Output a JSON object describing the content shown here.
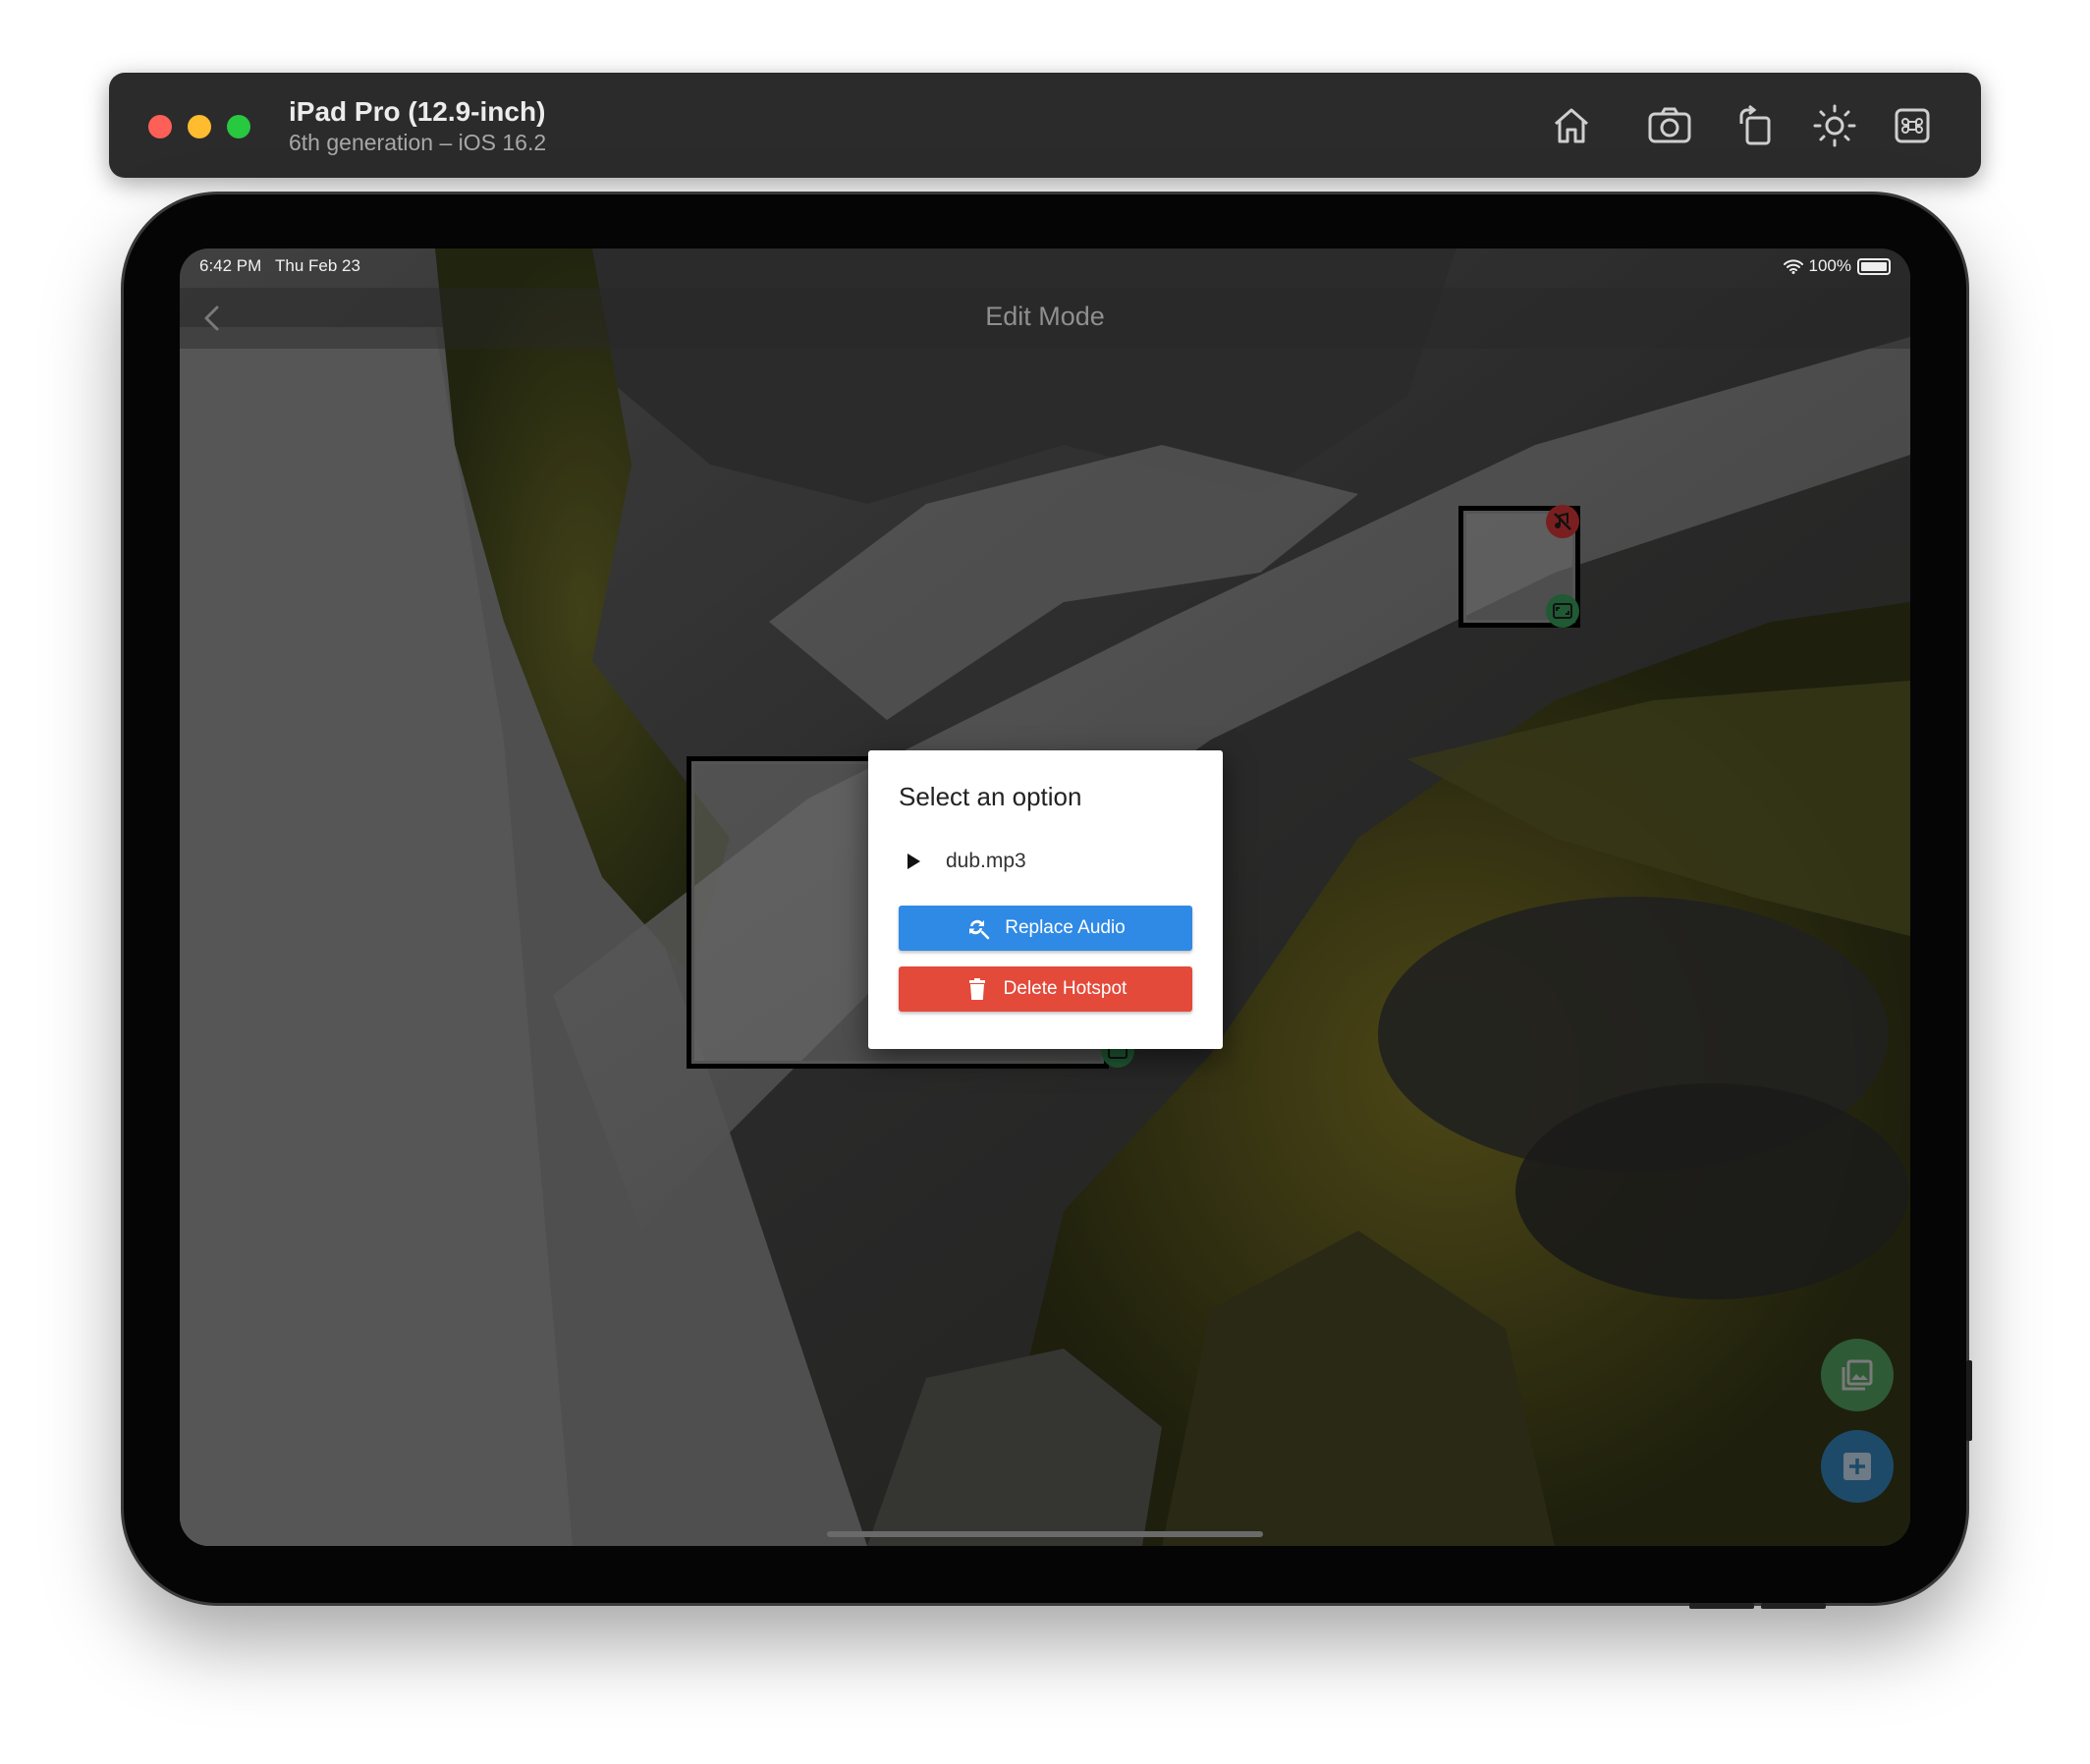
{
  "simulator": {
    "device_name": "iPad Pro (12.9-inch)",
    "device_detail": "6th generation – iOS 16.2",
    "toolbar_icons": [
      "home-icon",
      "screenshot-icon",
      "rotate-icon",
      "appearance-icon",
      "keyboard-command-icon"
    ]
  },
  "status_bar": {
    "time": "6:42 PM",
    "date": "Thu Feb 23",
    "battery": "100%"
  },
  "nav": {
    "title": "Edit Mode",
    "back_icon": "chevron-left-icon"
  },
  "dialog": {
    "title": "Select an option",
    "audio_file": "dub.mp3",
    "replace_label": "Replace Audio",
    "delete_label": "Delete Hotspot"
  },
  "fabs": {
    "gallery_icon": "photo-library-icon",
    "add_icon": "add-box-icon"
  },
  "colors": {
    "replace_button": "#2f8ae5",
    "delete_button": "#e34a3a",
    "fab_green": "#2f5a36",
    "fab_blue": "#1e4a6a"
  }
}
